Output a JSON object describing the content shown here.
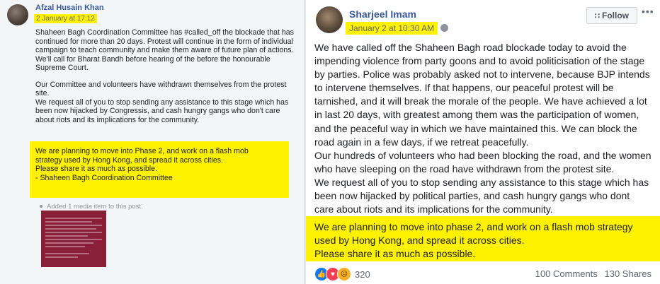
{
  "left_post": {
    "author": "Afzal Husain Khan",
    "time": "2 January at 17:12",
    "paragraph1": "Shaheen Bagh Coordination Committee has #called_off the blockade that has continued for more than 20 days. Protest will continue in the form of individual campaign to teach community and make them aware of future plan of actions. We'll call for Bharat Bandh before hearing of the before the honourable Supreme Court.",
    "paragraph2_line1": "Our Committee and volunteers have withdrawn themselves from the protest site.",
    "paragraph2_line2": "We request all of you to stop sending any assistance to this stage which has been now hijacked by Congressis, and cash hungry gangs who don't care about riots and its implications for the community.",
    "highlight": {
      "line1": "We are planning to move into Phase 2, and work on a flash mob",
      "line2": "strategy used by Hong Kong, and spread it across cities.",
      "line3": "Please share it as much as possible.",
      "line4": "- Shaheen Bagh Coordination Committee"
    },
    "media_note": "Added 1 media item to this post."
  },
  "right_post": {
    "author": "Sharjeel Imam",
    "time": "January 2 at 10:30 AM",
    "follow_label": "Follow",
    "body_lines": [
      "We have called off the Shaheen Bagh road blockade today to avoid the",
      "impending violence from party goons and to avoid politicisation of the stage",
      "by parties. Police was probably asked not to intervene, because BJP intends",
      "to intervene themselves. If that happens, our peaceful protest will be",
      "tarnished, and it will break the morale of the people. We have achieved a lot",
      "in last 20 days, with greatest among them was the participation of women,",
      "and the peaceful way in which we have maintained this. We can block the",
      "road again in a few days, if we retreat peacefully.",
      "Our hundreds of volunteers who had been blocking the road, and the women",
      "who have sleeping on the road have withdrawn from the protest site.",
      "We request all of you to stop sending any assistance to this stage which has",
      "been now hijacked by political parties, and cash hungry gangs who dont",
      "care about riots and its implications for the community."
    ],
    "highlight_lines": [
      "We are planning to move into phase 2, and work on a flash mob strategy",
      "used by Hong Kong, and spread it across cities.",
      "Please share it as much as possible."
    ],
    "reaction_count": "320",
    "comments": "100 Comments",
    "shares": "130 Shares"
  },
  "colors": {
    "highlight": "#fff200",
    "link": "#385898"
  },
  "icons": [
    "globe-icon",
    "rss-icon",
    "more-icon",
    "like-reaction-icon",
    "love-reaction-icon",
    "sad-reaction-icon"
  ]
}
